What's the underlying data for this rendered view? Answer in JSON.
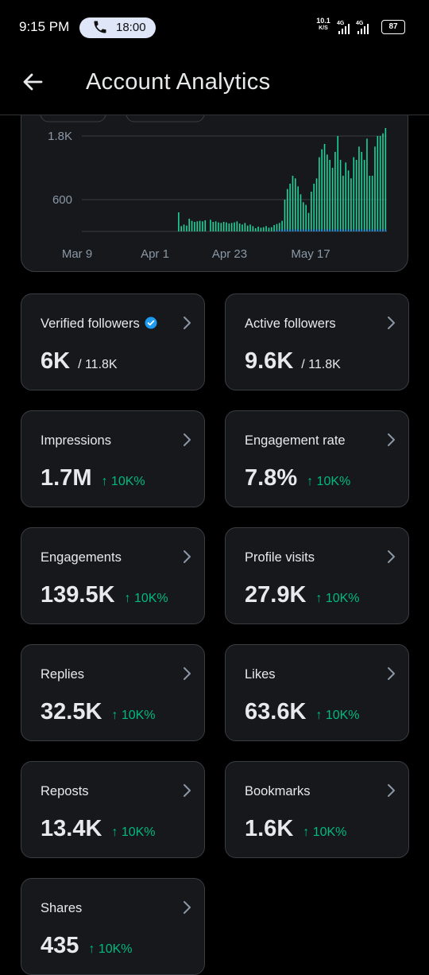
{
  "status_bar": {
    "time": "9:15 PM",
    "call_time": "18:00",
    "net_speed_top": "10.1",
    "net_speed_bottom": "K/S",
    "net_type_1": "4G",
    "net_type_2": "4G",
    "battery": "87"
  },
  "header": {
    "title": "Account Analytics"
  },
  "chart_data": {
    "type": "bar",
    "y_ticks": [
      "1.8K",
      "600"
    ],
    "x_ticks": [
      "Mar 9",
      "Apr 1",
      "Apr 23",
      "May 17"
    ],
    "ylim": [
      0,
      2100
    ],
    "series": [
      {
        "values": [
          0,
          0,
          0,
          0,
          0,
          0,
          0,
          0,
          0,
          0,
          0,
          0,
          0,
          0,
          0,
          0,
          0,
          0,
          0,
          0,
          0,
          0,
          0,
          0,
          0,
          0,
          0,
          0,
          0,
          0,
          0,
          0,
          0,
          0,
          0,
          0,
          360,
          100,
          130,
          110,
          240,
          200,
          180,
          190,
          200,
          190,
          210,
          0,
          220,
          180,
          190,
          170,
          160,
          180,
          170,
          150,
          160,
          170,
          190,
          150,
          130,
          160,
          110,
          130,
          100,
          60,
          90,
          70,
          80,
          100,
          70,
          80,
          120,
          140,
          160,
          200,
          600,
          800,
          900,
          1050,
          1000,
          850,
          700,
          550,
          500,
          350,
          750,
          900,
          1000,
          1400,
          1550,
          1650,
          1450,
          1350,
          1200,
          1500,
          1800,
          1350,
          1050,
          1300,
          1150,
          1000,
          1400,
          1350,
          1600,
          1500,
          1350,
          1750,
          1050,
          1050,
          1600,
          1800,
          1800,
          1850,
          1950
        ]
      },
      {
        "values": [
          0,
          0,
          0,
          0,
          0,
          0,
          0,
          0,
          0,
          0,
          0,
          0,
          0,
          0,
          0,
          0,
          0,
          0,
          0,
          0,
          0,
          0,
          0,
          0,
          0,
          0,
          0,
          0,
          0,
          0,
          0,
          0,
          0,
          0,
          0,
          0,
          0,
          0,
          0,
          0,
          0,
          0,
          0,
          0,
          0,
          0,
          0,
          0,
          0,
          0,
          0,
          0,
          0,
          0,
          0,
          0,
          0,
          0,
          0,
          0,
          0,
          0,
          0,
          0,
          0,
          0,
          0,
          0,
          0,
          0,
          0,
          0,
          0,
          20,
          30,
          40,
          40,
          40,
          40,
          40,
          40,
          40,
          40,
          40,
          40,
          40,
          40,
          40,
          40,
          40,
          40,
          40,
          40,
          40,
          40,
          40,
          40,
          40,
          40,
          40,
          40,
          40,
          40,
          40,
          40,
          40,
          40,
          40,
          40,
          40,
          40,
          40,
          40,
          40,
          40
        ]
      }
    ],
    "colors": {
      "primary": "#1fd39a",
      "secondary": "#1d9bf0"
    }
  },
  "cards": [
    {
      "label": "Verified followers",
      "value": "6K",
      "sub": "/ 11.8K",
      "verified": true
    },
    {
      "label": "Active followers",
      "value": "9.6K",
      "sub": "/ 11.8K"
    },
    {
      "label": "Impressions",
      "value": "1.7M",
      "delta": "↑ 10K%"
    },
    {
      "label": "Engagement rate",
      "value": "7.8%",
      "delta": "↑ 10K%"
    },
    {
      "label": "Engagements",
      "value": "139.5K",
      "delta": "↑ 10K%"
    },
    {
      "label": "Profile visits",
      "value": "27.9K",
      "delta": "↑ 10K%"
    },
    {
      "label": "Replies",
      "value": "32.5K",
      "delta": "↑ 10K%"
    },
    {
      "label": "Likes",
      "value": "63.6K",
      "delta": "↑ 10K%"
    },
    {
      "label": "Reposts",
      "value": "13.4K",
      "delta": "↑ 10K%"
    },
    {
      "label": "Bookmarks",
      "value": "1.6K",
      "delta": "↑ 10K%"
    },
    {
      "label": "Shares",
      "value": "435",
      "delta": "↑ 10K%"
    }
  ]
}
